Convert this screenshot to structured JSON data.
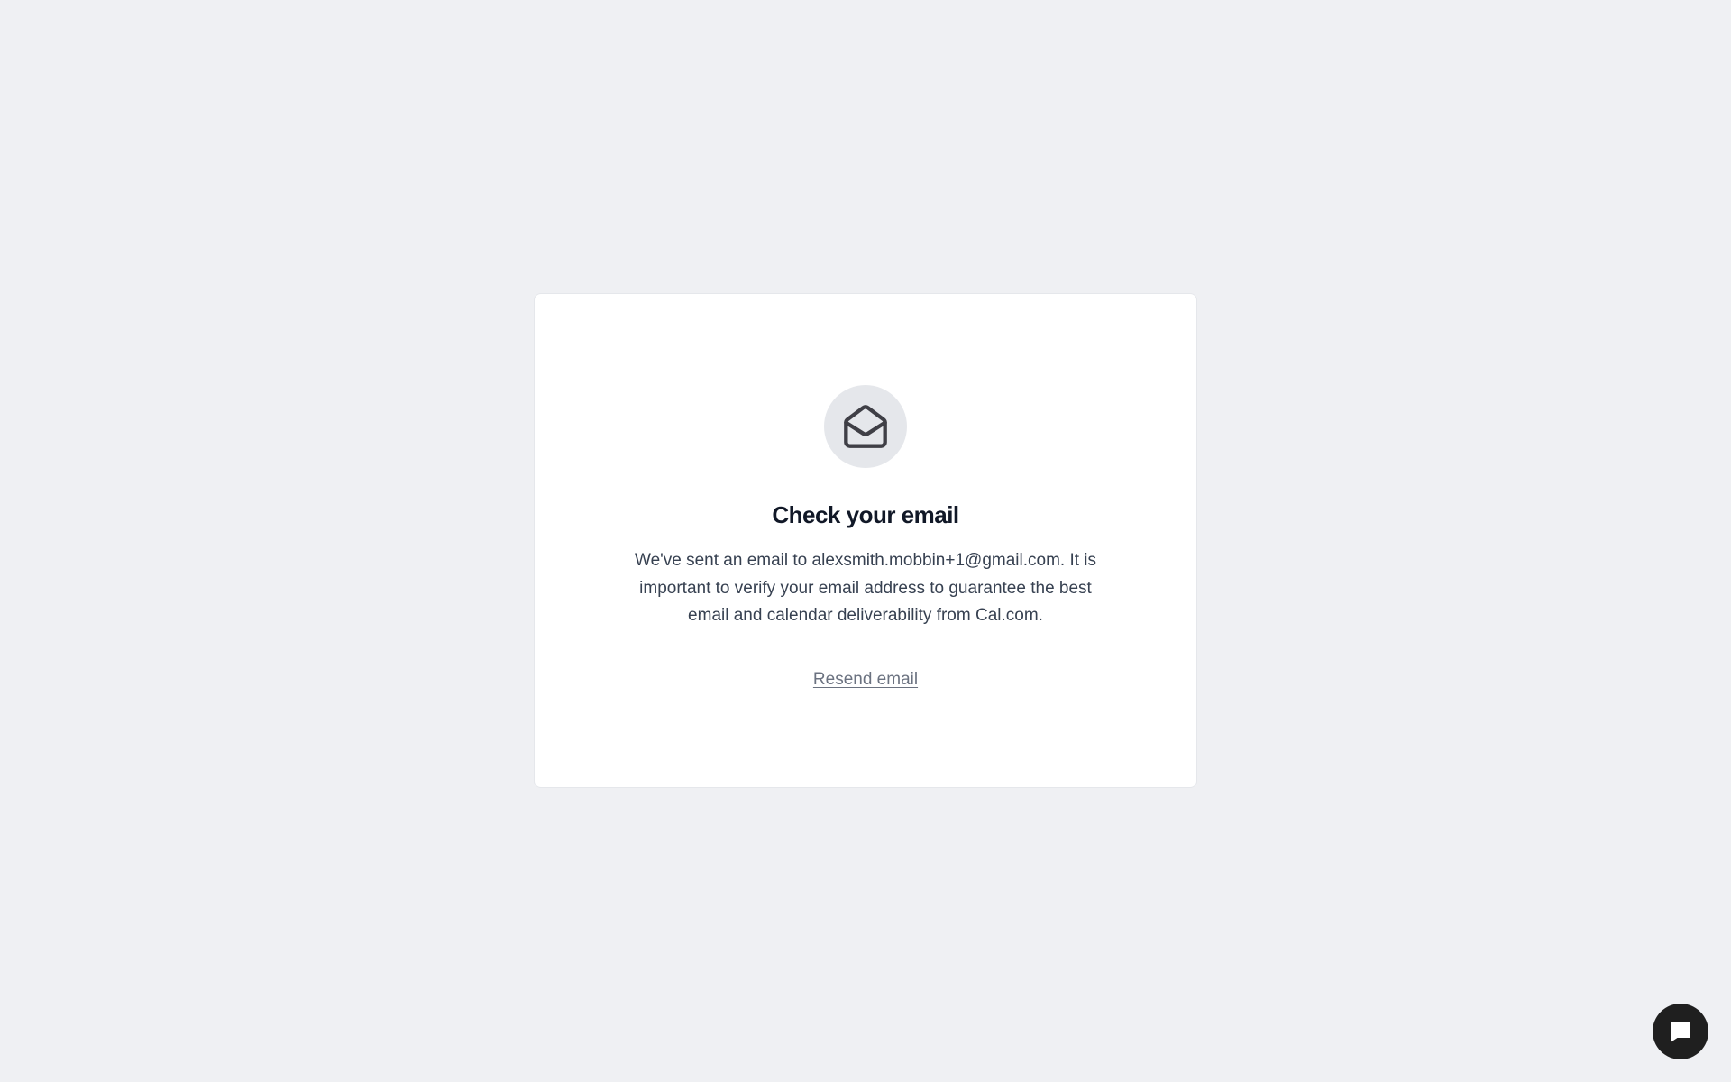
{
  "card": {
    "icon": "mail-open-icon",
    "title": "Check your email",
    "message": "We've sent an email to alexsmith.mobbin+1@gmail.com. It is important to verify your email address to guarantee the best email and calendar deliverability from Cal.com.",
    "resend_label": "Resend email"
  },
  "chat_widget": {
    "icon": "chat-bubble-icon"
  },
  "colors": {
    "background": "#eff0f3",
    "card": "#ffffff",
    "icon_circle": "#e5e7eb",
    "title": "#111827",
    "text": "#374151",
    "link": "#6b7280",
    "chat_button": "#1f1f1f"
  }
}
